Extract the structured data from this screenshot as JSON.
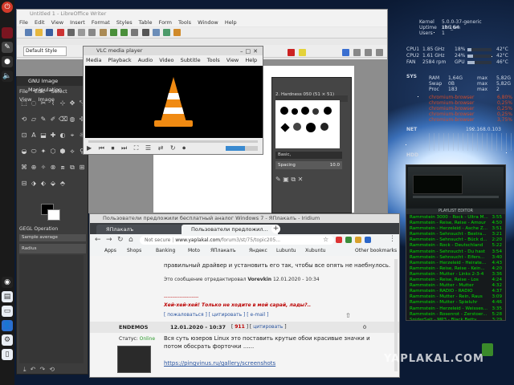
{
  "writer": {
    "title": "Untitled 1 - LibreOffice Writer",
    "menu": [
      "File",
      "Edit",
      "View",
      "Insert",
      "Format",
      "Styles",
      "Table",
      "Form",
      "Tools",
      "Window",
      "Help"
    ],
    "paragraph_style": "Default Style"
  },
  "vlc": {
    "title": "VLC media player",
    "menu": [
      "Media",
      "Playback",
      "Audio",
      "Video",
      "Subtitle",
      "Tools",
      "View",
      "Help"
    ],
    "controls": [
      "▶",
      "⏮",
      "⏹",
      "⏭",
      "⛶",
      "☰",
      "⇄",
      "↻",
      "⏺"
    ]
  },
  "gimp": {
    "title": "GNU Image Manipulation",
    "menu": [
      "File",
      "Edit",
      "Select",
      "View",
      "Image"
    ],
    "tool_options_title": "GEGL Operation",
    "option_sample": "Sample average",
    "option_radius": "Radius",
    "brushes_label": "2. Hardness 050 (51 × 51)",
    "brushes_filter": "Basic,",
    "spacing_label": "Spacing",
    "spacing_value": "10.0"
  },
  "browser": {
    "title": "Пользователи предложили бесплатный аналог Windows 7 - ЯПлакалъ - Iridium",
    "tabs": [
      {
        "label": "ЯПлакалъ",
        "active": false
      },
      {
        "label": "Пользователи предложил...",
        "active": true
      }
    ],
    "url": {
      "prefix": "Not secure",
      "host": "www.yaplakal.com",
      "path": "/forum3/st/75/topic205..."
    },
    "bookmarks": [
      "Apps",
      "Shops",
      "Banking",
      "Moto",
      "ЯПлакалъ",
      "Яндекс",
      "Lubuntu",
      "Xubuntu",
      "Other bookmarks"
    ],
    "post1": {
      "text": "правильный драйвер и установить его так, чтобы все опять не наебнулось.",
      "edited_prefix": "Это сообщение отредактировал",
      "edited_by": "Vorevkin",
      "edited_date": "12.01.2020 - 10:34",
      "dashes": "--------------------",
      "signature": "Хей-хей-хей! Только не ходите в мой сарай, лады?..",
      "actions": [
        "пожаловаться",
        "цитировать",
        "e-mail"
      ]
    },
    "post2": {
      "author": "ENDEMOS",
      "date": "12.01.2020 - 10:37",
      "post_number": "911",
      "quote_action": "цитировать",
      "score": "0",
      "status_label": "Статус:",
      "status_value": "Online",
      "text": "Вся суть юзеров Linux это поставить крутые обои красивые значки и потом обосрать форточки ......",
      "link": "https://pingvinus.ru/gallery/screenshots"
    }
  },
  "conky": {
    "kernel_label": "Kernel",
    "kernel_value": "5.0.0-37-generic x86_64",
    "uptime_label": "Uptime",
    "uptime_value": "1h 16m",
    "users_label": "Users",
    "users_value": "1",
    "cpu_rows": [
      {
        "label": "CPU1",
        "freq": "1.85 GHz",
        "pct": "18%",
        "temp": "42°C",
        "fill": 0.18
      },
      {
        "label": "CPU2",
        "freq": "1.61 GHz",
        "pct": "24%",
        "temp": "42°C",
        "fill": 0.24
      },
      {
        "label": "FAN",
        "freq": "2584 rpm",
        "pct": "GPU",
        "temp": "46°C",
        "fill": 0.3
      }
    ],
    "sys_label": "SYS",
    "ram": {
      "label": "RAM",
      "value": "1,64G",
      "max_label": "max",
      "max": "5,82G"
    },
    "swap": {
      "label": "Swap",
      "value": "0B",
      "max_label": "max",
      "max": "5,82G"
    },
    "proc": {
      "label": "Proc",
      "value": "183",
      "max_label": "max",
      "max": "2"
    },
    "processes": [
      {
        "name": "chromium-browser",
        "pct": "6,80%"
      },
      {
        "name": "chromium-browser",
        "pct": "0,25%"
      },
      {
        "name": "chromium-browser",
        "pct": "0,25%"
      },
      {
        "name": "chromium-browser",
        "pct": "0,25%"
      },
      {
        "name": "chromium-browser",
        "pct": "3,75%"
      }
    ],
    "net_label": "NET",
    "net_ip": "192.168.0.103",
    "hdd_label": "HDD"
  },
  "winamp": {
    "title": "PLAYLIST EDITOR",
    "playlist": [
      {
        "title": "Rammstein 3000 - Rock - Ultra M...",
        "dur": "3:55"
      },
      {
        "title": "Rammstein - Reise, Reise - Amour",
        "dur": "4:50"
      },
      {
        "title": "Rammstein - Herzeleid - Asche Z...",
        "dur": "3:51"
      },
      {
        "title": "Rammstein - Sehnsucht - Bestra...",
        "dur": "3:21"
      },
      {
        "title": "Rammstein - Sehnsucht - Bück d...",
        "dur": "2:20"
      },
      {
        "title": "Rammstein - Rock - Deutschland",
        "dur": "5:22"
      },
      {
        "title": "Rammstein - Sehnsucht - Du hast",
        "dur": "3:54"
      },
      {
        "title": "Rammstein - Sehnsucht - Eifers...",
        "dur": "3:40"
      },
      {
        "title": "Rammstein - Herzeleid - Heirate...",
        "dur": "4:43"
      },
      {
        "title": "Rammstein - Reise, Reise - Kein...",
        "dur": "4:20"
      },
      {
        "title": "Rammstein - Mutter - Links 2-3-4",
        "dur": "3:36"
      },
      {
        "title": "Rammstein - Reise, Reise - Los",
        "dur": "4:24"
      },
      {
        "title": "Rammstein - Mutter - Mutter",
        "dur": "4:32"
      },
      {
        "title": "Rammstein - RADIO - RADIO",
        "dur": "4:37"
      },
      {
        "title": "Rammstein - Mutter - Rein, Raus",
        "dur": "3:09"
      },
      {
        "title": "Rammstein - Mutter - Spieluhr",
        "dur": "4:46"
      },
      {
        "title": "Rammstein - Herzeleid - Weisses...",
        "dur": "3:35"
      },
      {
        "title": "Rammstein - Rosenrot - Zerstoer...",
        "dur": "5:28"
      },
      {
        "title": "SpiderSalt - MP3 - Black Betty",
        "dur": "3:29"
      },
      {
        "title": "Randerbalt - Ninja Assassin Sou...",
        "dur": "5:10"
      },
      {
        "title": "Stoner Train - MP3 - Cannibal H...",
        "dur": "3:58"
      }
    ]
  },
  "watermark": "YAPLAKAL.COM"
}
